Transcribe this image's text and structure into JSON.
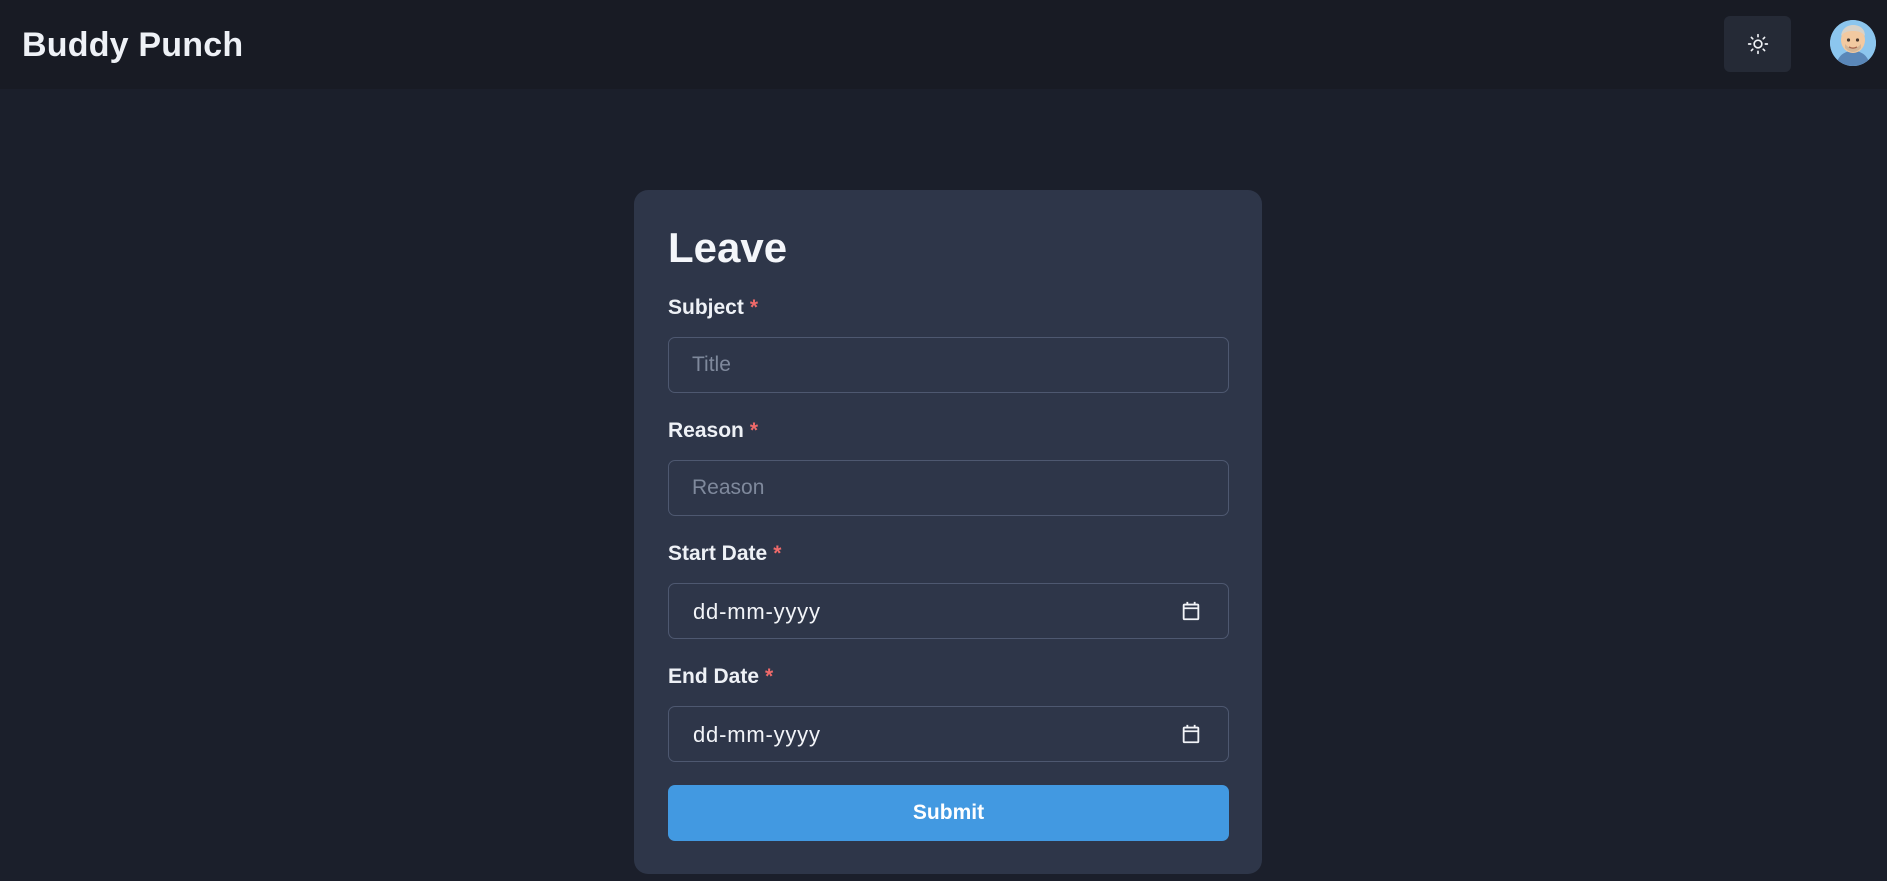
{
  "header": {
    "brand": "Buddy Punch",
    "theme_toggle_icon": "sun-icon",
    "avatar_icon": "user-avatar"
  },
  "form": {
    "title": "Leave",
    "required_mark": "*",
    "subject": {
      "label": "Subject",
      "placeholder": "Title",
      "value": ""
    },
    "reason": {
      "label": "Reason",
      "placeholder": "Reason",
      "value": ""
    },
    "start_date": {
      "label": "Start Date",
      "value": "dd-mm-yyyy",
      "icon": "calendar-icon"
    },
    "end_date": {
      "label": "End Date",
      "value": "dd-mm-yyyy",
      "icon": "calendar-icon"
    },
    "submit_label": "Submit"
  },
  "colors": {
    "page_bg": "#1b1f2b",
    "header_bg": "#181b24",
    "card_bg": "#2e3649",
    "accent": "#4299e1",
    "required": "#f06a6a"
  }
}
